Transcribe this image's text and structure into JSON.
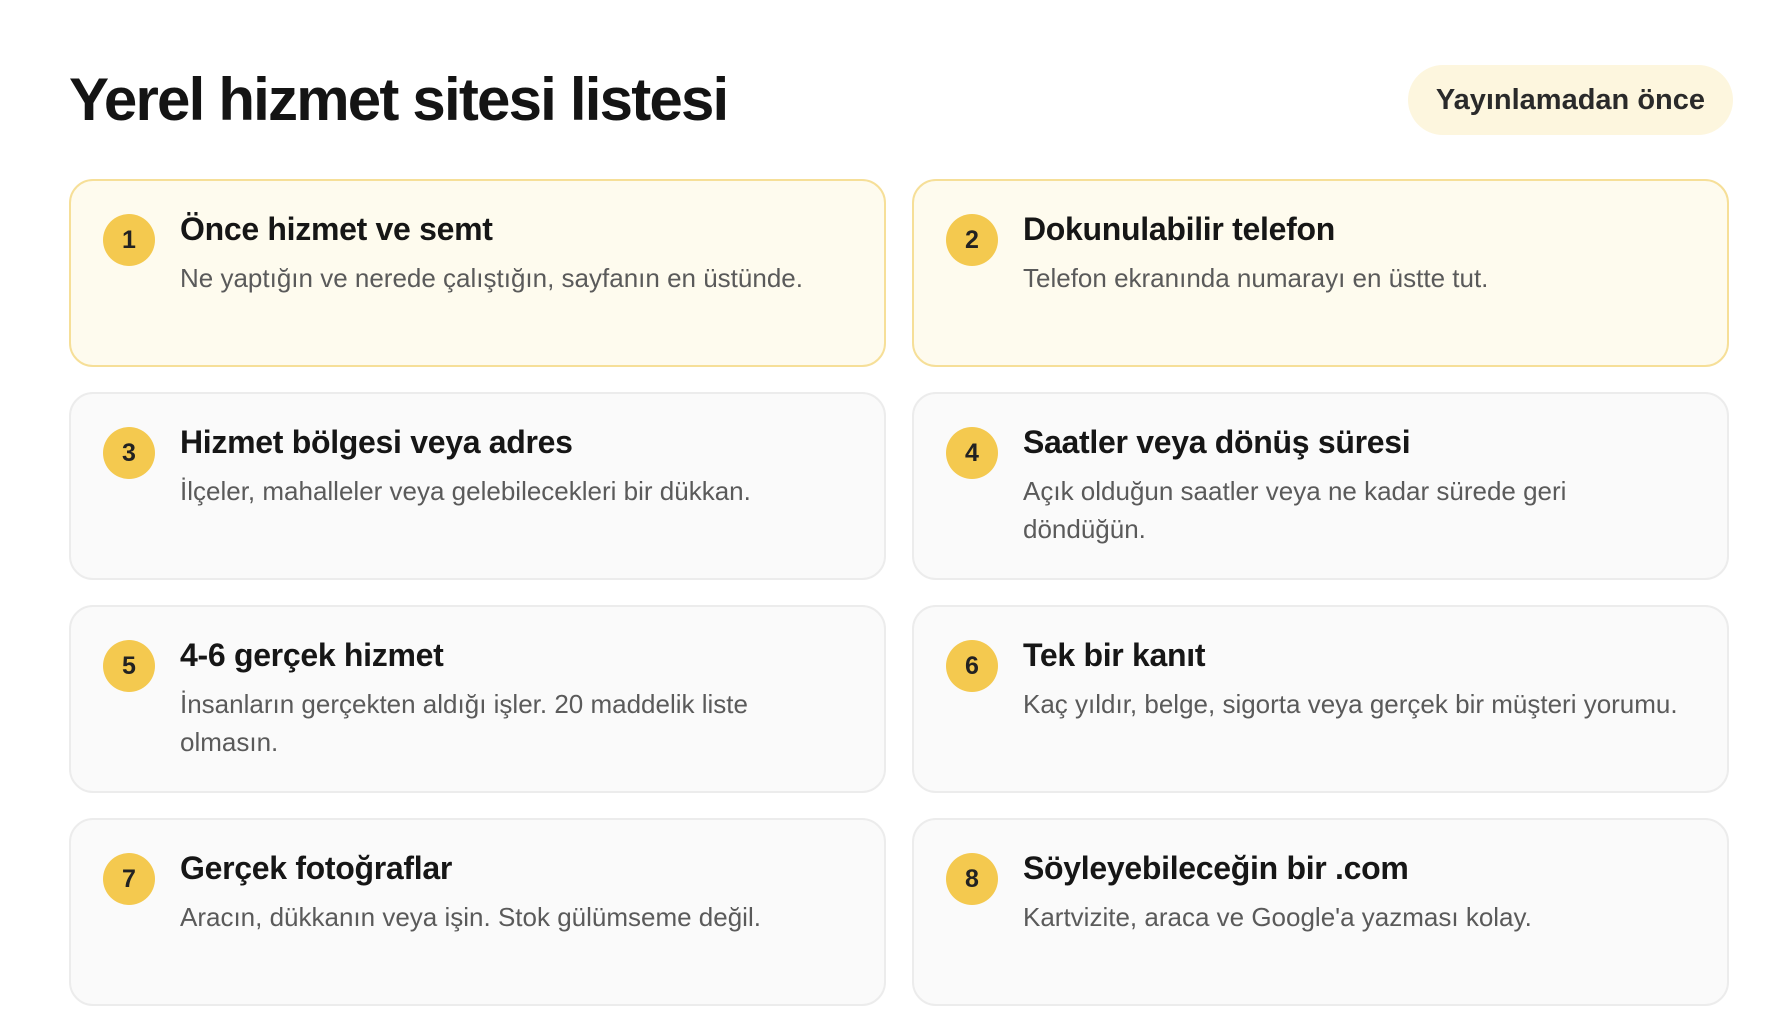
{
  "page": {
    "title": "Yerel hizmet sitesi listesi",
    "badge": "Yayınlamadan önce"
  },
  "colors": {
    "accent": "#f4c94f",
    "highlight_bg": "#fefbee",
    "highlight_border": "#f6df98",
    "badge_bg": "#fdf6de",
    "card_bg": "#fafafa",
    "card_border": "#ececec"
  },
  "items": [
    {
      "number": "1",
      "title": "Önce hizmet ve semt",
      "desc": "Ne yaptığın ve nerede çalıştığın, sayfanın en üstünde.",
      "highlighted": true
    },
    {
      "number": "2",
      "title": "Dokunulabilir telefon",
      "desc": "Telefon ekranında numarayı en üstte tut.",
      "highlighted": true
    },
    {
      "number": "3",
      "title": "Hizmet bölgesi veya adres",
      "desc": "İlçeler, mahalleler veya gelebilecekleri bir dükkan.",
      "highlighted": false
    },
    {
      "number": "4",
      "title": "Saatler veya dönüş süresi",
      "desc": "Açık olduğun saatler veya ne kadar sürede geri döndüğün.",
      "highlighted": false
    },
    {
      "number": "5",
      "title": "4-6 gerçek hizmet",
      "desc": "İnsanların gerçekten aldığı işler. 20 maddelik liste olmasın.",
      "highlighted": false
    },
    {
      "number": "6",
      "title": "Tek bir kanıt",
      "desc": "Kaç yıldır, belge, sigorta veya gerçek bir müşteri yorumu.",
      "highlighted": false
    },
    {
      "number": "7",
      "title": "Gerçek fotoğraflar",
      "desc": "Aracın, dükkanın veya işin. Stok gülümseme değil.",
      "highlighted": false
    },
    {
      "number": "8",
      "title": "Söyleyebileceğin bir .com",
      "desc": "Kartvizite, araca ve Google'a yazması kolay.",
      "highlighted": false
    }
  ]
}
